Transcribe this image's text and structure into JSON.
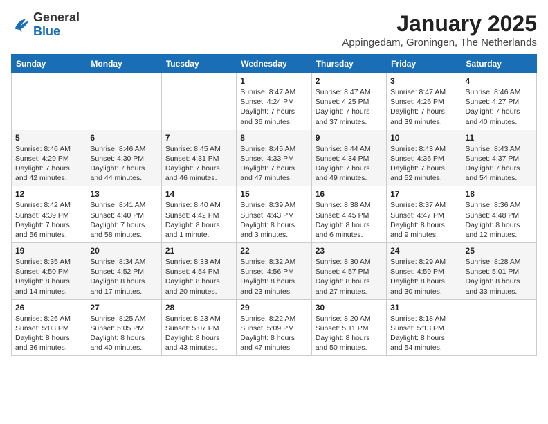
{
  "logo": {
    "general": "General",
    "blue": "Blue"
  },
  "header": {
    "month_year": "January 2025",
    "location": "Appingedam, Groningen, The Netherlands"
  },
  "weekdays": [
    "Sunday",
    "Monday",
    "Tuesday",
    "Wednesday",
    "Thursday",
    "Friday",
    "Saturday"
  ],
  "weeks": [
    [
      {
        "day": "",
        "info": ""
      },
      {
        "day": "",
        "info": ""
      },
      {
        "day": "",
        "info": ""
      },
      {
        "day": "1",
        "info": "Sunrise: 8:47 AM\nSunset: 4:24 PM\nDaylight: 7 hours and 36 minutes."
      },
      {
        "day": "2",
        "info": "Sunrise: 8:47 AM\nSunset: 4:25 PM\nDaylight: 7 hours and 37 minutes."
      },
      {
        "day": "3",
        "info": "Sunrise: 8:47 AM\nSunset: 4:26 PM\nDaylight: 7 hours and 39 minutes."
      },
      {
        "day": "4",
        "info": "Sunrise: 8:46 AM\nSunset: 4:27 PM\nDaylight: 7 hours and 40 minutes."
      }
    ],
    [
      {
        "day": "5",
        "info": "Sunrise: 8:46 AM\nSunset: 4:29 PM\nDaylight: 7 hours and 42 minutes."
      },
      {
        "day": "6",
        "info": "Sunrise: 8:46 AM\nSunset: 4:30 PM\nDaylight: 7 hours and 44 minutes."
      },
      {
        "day": "7",
        "info": "Sunrise: 8:45 AM\nSunset: 4:31 PM\nDaylight: 7 hours and 46 minutes."
      },
      {
        "day": "8",
        "info": "Sunrise: 8:45 AM\nSunset: 4:33 PM\nDaylight: 7 hours and 47 minutes."
      },
      {
        "day": "9",
        "info": "Sunrise: 8:44 AM\nSunset: 4:34 PM\nDaylight: 7 hours and 49 minutes."
      },
      {
        "day": "10",
        "info": "Sunrise: 8:43 AM\nSunset: 4:36 PM\nDaylight: 7 hours and 52 minutes."
      },
      {
        "day": "11",
        "info": "Sunrise: 8:43 AM\nSunset: 4:37 PM\nDaylight: 7 hours and 54 minutes."
      }
    ],
    [
      {
        "day": "12",
        "info": "Sunrise: 8:42 AM\nSunset: 4:39 PM\nDaylight: 7 hours and 56 minutes."
      },
      {
        "day": "13",
        "info": "Sunrise: 8:41 AM\nSunset: 4:40 PM\nDaylight: 7 hours and 58 minutes."
      },
      {
        "day": "14",
        "info": "Sunrise: 8:40 AM\nSunset: 4:42 PM\nDaylight: 8 hours and 1 minute."
      },
      {
        "day": "15",
        "info": "Sunrise: 8:39 AM\nSunset: 4:43 PM\nDaylight: 8 hours and 3 minutes."
      },
      {
        "day": "16",
        "info": "Sunrise: 8:38 AM\nSunset: 4:45 PM\nDaylight: 8 hours and 6 minutes."
      },
      {
        "day": "17",
        "info": "Sunrise: 8:37 AM\nSunset: 4:47 PM\nDaylight: 8 hours and 9 minutes."
      },
      {
        "day": "18",
        "info": "Sunrise: 8:36 AM\nSunset: 4:48 PM\nDaylight: 8 hours and 12 minutes."
      }
    ],
    [
      {
        "day": "19",
        "info": "Sunrise: 8:35 AM\nSunset: 4:50 PM\nDaylight: 8 hours and 14 minutes."
      },
      {
        "day": "20",
        "info": "Sunrise: 8:34 AM\nSunset: 4:52 PM\nDaylight: 8 hours and 17 minutes."
      },
      {
        "day": "21",
        "info": "Sunrise: 8:33 AM\nSunset: 4:54 PM\nDaylight: 8 hours and 20 minutes."
      },
      {
        "day": "22",
        "info": "Sunrise: 8:32 AM\nSunset: 4:56 PM\nDaylight: 8 hours and 23 minutes."
      },
      {
        "day": "23",
        "info": "Sunrise: 8:30 AM\nSunset: 4:57 PM\nDaylight: 8 hours and 27 minutes."
      },
      {
        "day": "24",
        "info": "Sunrise: 8:29 AM\nSunset: 4:59 PM\nDaylight: 8 hours and 30 minutes."
      },
      {
        "day": "25",
        "info": "Sunrise: 8:28 AM\nSunset: 5:01 PM\nDaylight: 8 hours and 33 minutes."
      }
    ],
    [
      {
        "day": "26",
        "info": "Sunrise: 8:26 AM\nSunset: 5:03 PM\nDaylight: 8 hours and 36 minutes."
      },
      {
        "day": "27",
        "info": "Sunrise: 8:25 AM\nSunset: 5:05 PM\nDaylight: 8 hours and 40 minutes."
      },
      {
        "day": "28",
        "info": "Sunrise: 8:23 AM\nSunset: 5:07 PM\nDaylight: 8 hours and 43 minutes."
      },
      {
        "day": "29",
        "info": "Sunrise: 8:22 AM\nSunset: 5:09 PM\nDaylight: 8 hours and 47 minutes."
      },
      {
        "day": "30",
        "info": "Sunrise: 8:20 AM\nSunset: 5:11 PM\nDaylight: 8 hours and 50 minutes."
      },
      {
        "day": "31",
        "info": "Sunrise: 8:18 AM\nSunset: 5:13 PM\nDaylight: 8 hours and 54 minutes."
      },
      {
        "day": "",
        "info": ""
      }
    ]
  ]
}
